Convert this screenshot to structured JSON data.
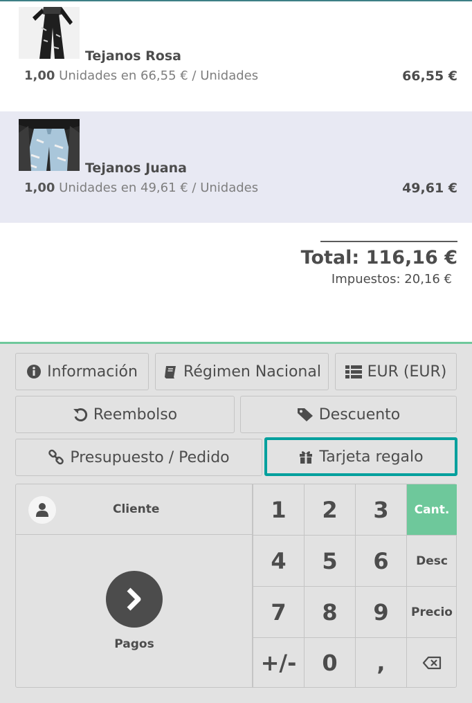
{
  "orderlines": [
    {
      "name": "Tejanos Rosa",
      "quantity": "1,00",
      "unit_text": "Unidades en 66,55 € / Unidades",
      "price": "66,55 €",
      "image": "black-ripped-jeans",
      "selected": false
    },
    {
      "name": "Tejanos Juana",
      "quantity": "1,00",
      "unit_text": "Unidades en 49,61 € / Unidades",
      "price": "49,61 €",
      "image": "light-ripped-jeans",
      "selected": true
    }
  ],
  "summary": {
    "total": "Total: 116,16 €",
    "taxes": "Impuestos: 20,16 €"
  },
  "control_buttons": [
    {
      "label": "Información",
      "icon": "info-icon"
    },
    {
      "label": "Régimen Nacional",
      "icon": "book-icon"
    },
    {
      "label": "EUR (EUR)",
      "icon": "list-icon"
    },
    {
      "label": "Reembolso",
      "icon": "undo-icon"
    },
    {
      "label": "Descuento",
      "icon": "tag-icon"
    },
    {
      "label": "Presupuesto / Pedido",
      "icon": "link-icon"
    },
    {
      "label": "Tarjeta regalo",
      "icon": "gift-icon",
      "highlighted": true
    }
  ],
  "customer": {
    "label": "Cliente",
    "icon": "user-icon"
  },
  "payment": {
    "label": "Pagos",
    "icon": "chevron-right-icon"
  },
  "numpad": {
    "keys": [
      "1",
      "2",
      "3",
      "4",
      "5",
      "6",
      "7",
      "8",
      "9",
      "+/-",
      "0",
      ","
    ],
    "modes": [
      "Cant.",
      "Desc",
      "Precio"
    ],
    "active_mode": "Cant.",
    "backspace_icon": "backspace-icon"
  },
  "colors": {
    "accent": "#6ec89b",
    "highlight_border": "#00a09d",
    "selected_line": "#e8e9f3",
    "text": "#4c4c4c"
  }
}
